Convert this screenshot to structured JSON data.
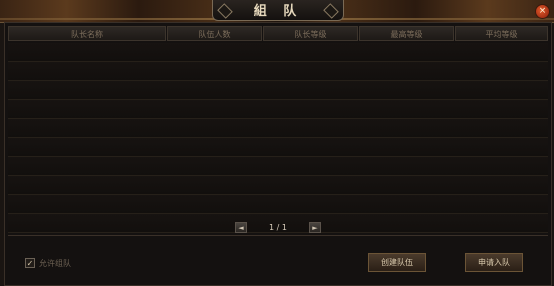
{
  "window": {
    "title": "組 队",
    "close_glyph": "×"
  },
  "table": {
    "columns": [
      "队长名称",
      "队伍人数",
      "队长等级",
      "最高等级",
      "平均等级"
    ],
    "rows": [
      "",
      "",
      "",
      "",
      "",
      "",
      "",
      "",
      "",
      ""
    ]
  },
  "pager": {
    "prev_glyph": "◄",
    "next_glyph": "►",
    "page_text": "1 / 1"
  },
  "footer": {
    "allow_label": "允许组队",
    "allow_checked": true,
    "check_glyph": "✓",
    "create_label": "创建队伍",
    "apply_label": "申请入队"
  }
}
